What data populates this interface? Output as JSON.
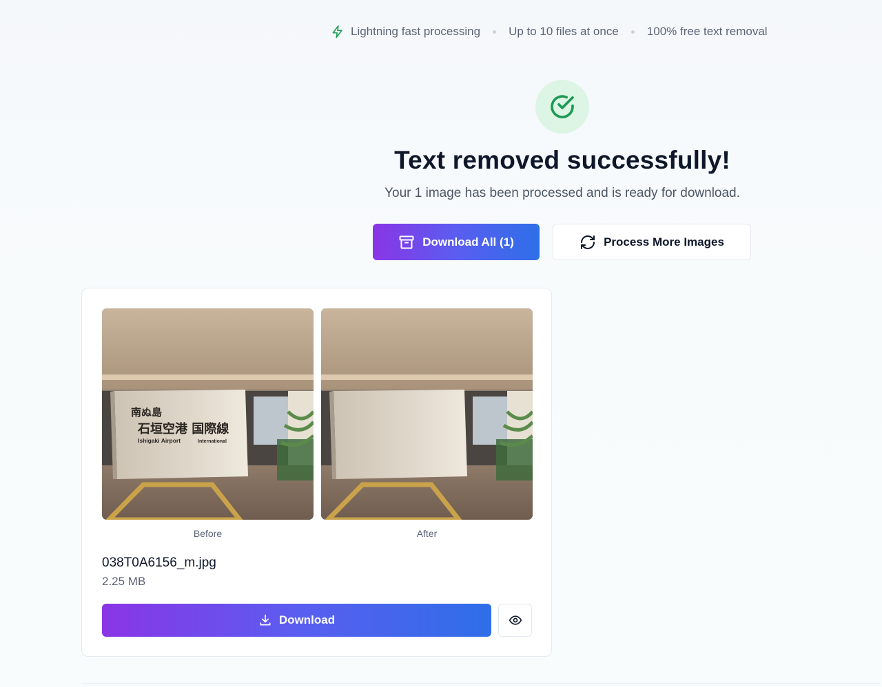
{
  "features": [
    {
      "label": "Lightning fast processing",
      "icon": "lightning-icon",
      "icon_color": "#22a05a"
    },
    {
      "label": "Up to 10 files at once"
    },
    {
      "label": "100% free text removal"
    }
  ],
  "status": {
    "icon": "check-circle-icon",
    "icon_color": "#1f9a54",
    "title": "Text removed successfully!",
    "subtitle": "Your 1 image has been processed and is ready for download."
  },
  "actions": {
    "download_all_label": "Download All (1)",
    "download_all_icon": "archive-icon",
    "process_more_label": "Process More Images",
    "process_more_icon": "refresh-icon"
  },
  "result": {
    "before_caption": "Before",
    "after_caption": "After",
    "before_sign": {
      "line1": "南ぬ島",
      "line2": "石垣空港 国際線",
      "line3_left": "Ishigaki Airport",
      "line3_right": "International"
    },
    "file_name": "038T0A6156_m.jpg",
    "file_size": "2.25 MB",
    "download_label": "Download",
    "download_icon": "download-icon",
    "preview_icon": "eye-icon"
  },
  "colors": {
    "accent_start": "#8a35e6",
    "accent_end": "#2e6fe8",
    "success_bg": "#dcf5e4"
  }
}
